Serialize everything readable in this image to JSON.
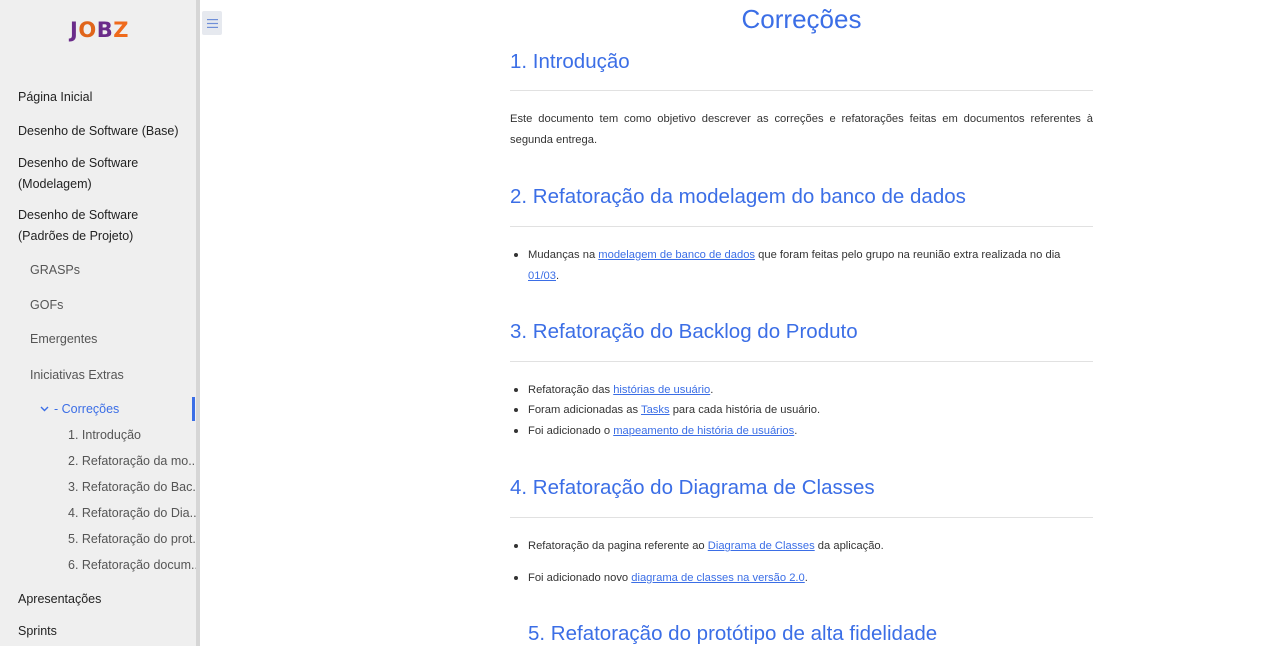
{
  "logo": {
    "j": "J",
    "o": "O",
    "b": "B",
    "z": "Z"
  },
  "sidebar": {
    "items": [
      {
        "label": "Página Inicial"
      },
      {
        "label": "Desenho de Software (Base)"
      },
      {
        "label_line1": "Desenho de Software",
        "label_line2": "(Modelagem)"
      },
      {
        "label_line1": "Desenho de Software",
        "label_line2": "(Padrões de Projeto)"
      },
      {
        "label": "GRASPs"
      },
      {
        "label": "GOFs"
      },
      {
        "label": "Emergentes"
      },
      {
        "label": "Iniciativas Extras"
      },
      {
        "label": "- Correções"
      },
      {
        "label": "1. Introdução"
      },
      {
        "label": "2. Refatoração da mo..."
      },
      {
        "label": "3. Refatoração do Bac..."
      },
      {
        "label": "4. Refatoração do Dia..."
      },
      {
        "label": "5. Refatoração do prot..."
      },
      {
        "label": "6. Refatoração docum..."
      },
      {
        "label": "Apresentações"
      },
      {
        "label": "Sprints"
      }
    ]
  },
  "main": {
    "title": "Correções",
    "sections": [
      {
        "heading": "1. Introdução",
        "text": "Este documento tem como objetivo descrever as correções e refatorações feitas em documentos referentes à segunda entrega."
      },
      {
        "heading": "2. Refatoração da modelagem do banco de dados",
        "bullets": [
          {
            "pre": "Mudanças na ",
            "link": "modelagem de banco de dados",
            "mid": " que foram feitas pelo grupo na reunião extra realizada no dia ",
            "link2": "01/03",
            "post": "."
          }
        ]
      },
      {
        "heading": "3. Refatoração do Backlog do Produto",
        "bullets": [
          {
            "pre": "Refatoração das ",
            "link": "histórias de usuário",
            "post": "."
          },
          {
            "pre": "Foram adicionadas as ",
            "link": "Tasks",
            "post": " para cada história de usuário."
          },
          {
            "pre": "Foi adicionado o ",
            "link": "mapeamento de história de usuários",
            "post": "."
          }
        ]
      },
      {
        "heading": "4. Refatoração do Diagrama de Classes",
        "bullets": [
          {
            "pre": "Refatoração da pagina referente ao ",
            "link": "Diagrama de Classes",
            "post": " da aplicação."
          },
          {
            "pre": "Foi adicionado novo ",
            "link": "diagrama de classes na versão 2.0",
            "post": "."
          }
        ]
      },
      {
        "heading": "5. Refatoração do protótipo de alta fidelidade"
      }
    ]
  },
  "colors": {
    "accent": "#3b6ee6",
    "sidebar_bg": "#efefef"
  }
}
